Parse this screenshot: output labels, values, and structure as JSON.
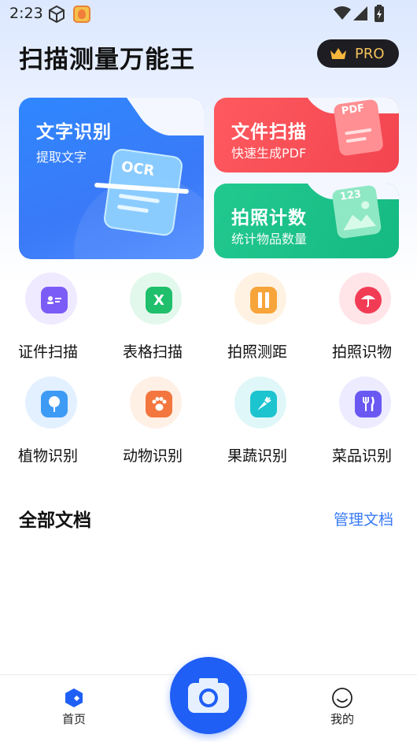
{
  "status_bar": {
    "time": "2:23"
  },
  "header": {
    "title": "扫描测量万能王",
    "pro_label": "PRO"
  },
  "feature_cards": {
    "ocr": {
      "title": "文字识别",
      "subtitle": "提取文字",
      "badge": "OCR"
    },
    "scan": {
      "title": "文件扫描",
      "subtitle": "快速生成PDF",
      "badge": "PDF"
    },
    "count": {
      "title": "拍照计数",
      "subtitle": "统计物品数量",
      "badge": "123"
    }
  },
  "tools": [
    {
      "label": "证件扫描",
      "icon": "id-card-icon",
      "color": "#7c5cf6"
    },
    {
      "label": "表格扫描",
      "icon": "excel-icon",
      "color": "#1fbf6b"
    },
    {
      "label": "拍照测距",
      "icon": "ruler-icon",
      "color": "#f7a43a"
    },
    {
      "label": "拍照识物",
      "icon": "umbrella-icon",
      "color": "#f23c55"
    },
    {
      "label": "植物识别",
      "icon": "tree-icon",
      "color": "#3d9bf5"
    },
    {
      "label": "动物识别",
      "icon": "paw-icon",
      "color": "#f3763f"
    },
    {
      "label": "果蔬识别",
      "icon": "carrot-icon",
      "color": "#1cc4d0"
    },
    {
      "label": "菜品识别",
      "icon": "cutlery-icon",
      "color": "#6a58f2"
    }
  ],
  "documents": {
    "title": "全部文档",
    "manage_label": "管理文档"
  },
  "bottom_nav": {
    "home_label": "首页",
    "mine_label": "我的"
  },
  "colors": {
    "accent": "#1f5ff6",
    "link": "#3a7bf5"
  }
}
